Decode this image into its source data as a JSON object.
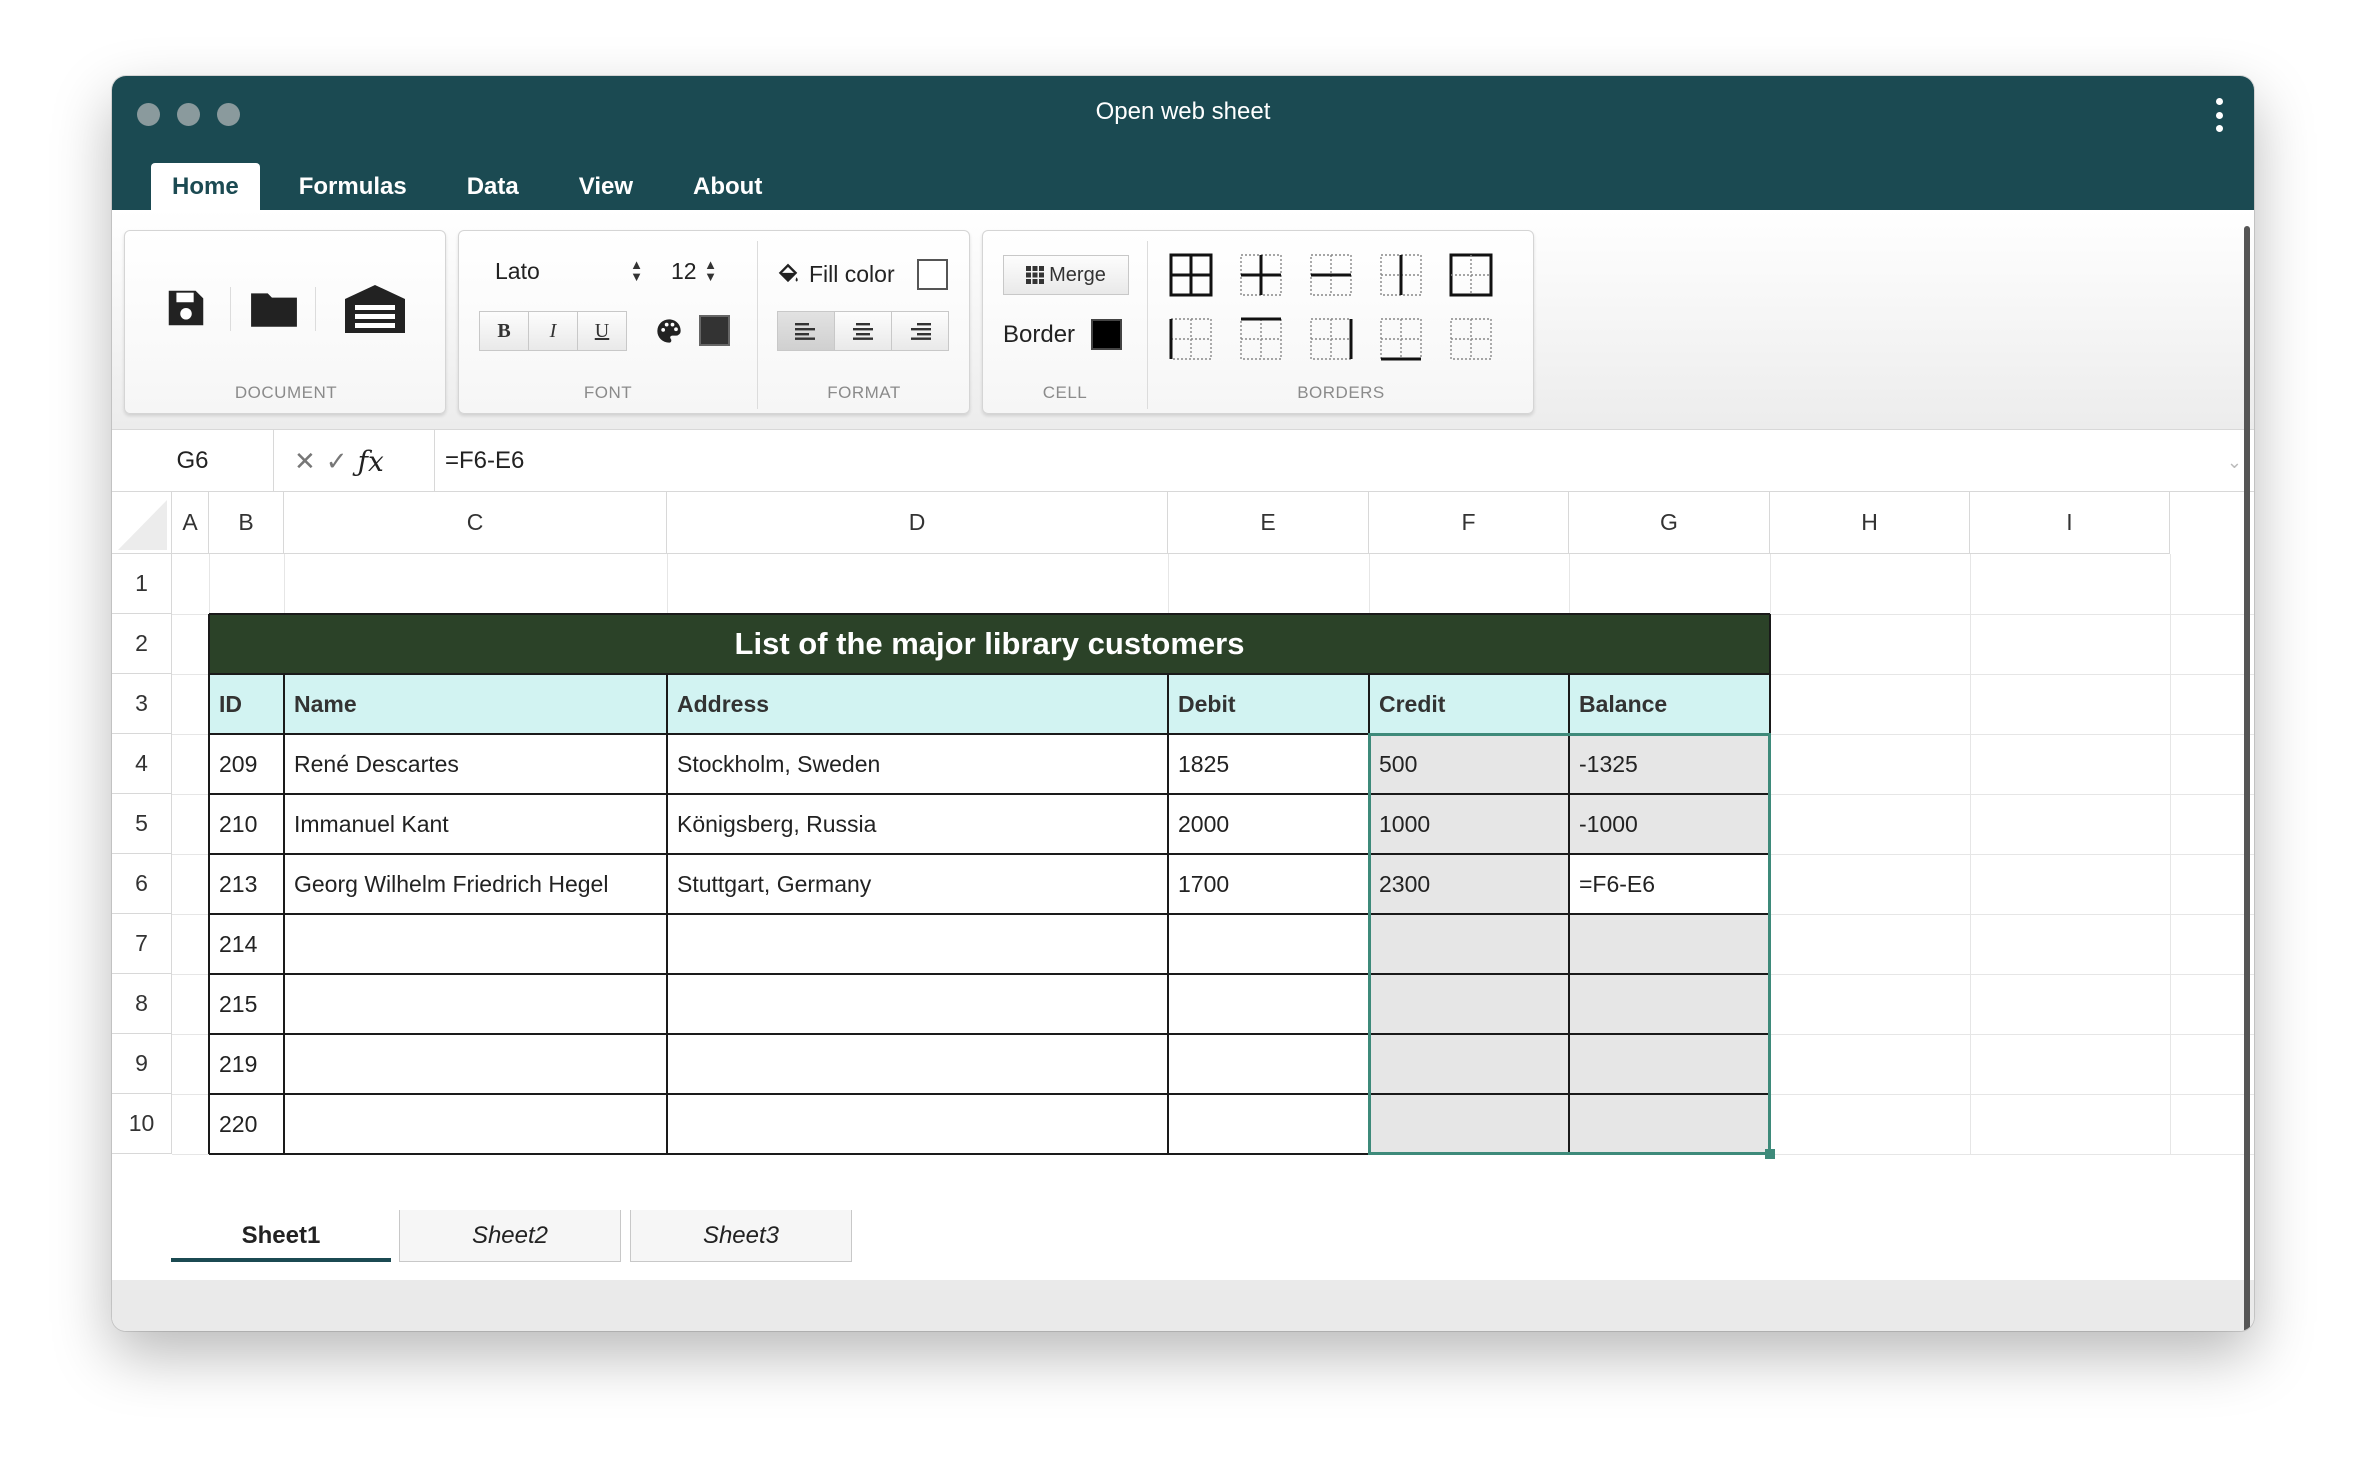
{
  "window": {
    "title": "Open web sheet"
  },
  "menu_tabs": [
    "Home",
    "Formulas",
    "Data",
    "View",
    "About"
  ],
  "ribbon": {
    "document_label": "DOCUMENT",
    "font_label": "FONT",
    "format_label": "FORMAT",
    "cell_label": "CELL",
    "borders_label": "BORDERS",
    "font_family": "Lato",
    "font_size": "12",
    "bold": "B",
    "italic": "I",
    "underline": "U",
    "fill_color_label": "Fill color",
    "merge_label": "Merge",
    "border_label": "Border",
    "font_color": "#333333",
    "border_color": "#000000"
  },
  "formula_bar": {
    "cell_ref": "G6",
    "formula": "=F6-E6"
  },
  "columns": [
    "A",
    "B",
    "C",
    "D",
    "E",
    "F",
    "G",
    "H",
    "I"
  ],
  "rows": [
    "1",
    "2",
    "3",
    "4",
    "5",
    "6",
    "7",
    "8",
    "9",
    "10"
  ],
  "table": {
    "title": "List of the major library customers",
    "headers": [
      "ID",
      "Name",
      "Address",
      "Debit",
      "Credit",
      "Balance"
    ],
    "data": [
      [
        "209",
        "René Descartes",
        "Stockholm, Sweden",
        "1825",
        "500",
        "-1325"
      ],
      [
        "210",
        "Immanuel Kant",
        "Königsberg, Russia",
        "2000",
        "1000",
        "-1000"
      ],
      [
        "213",
        "Georg Wilhelm Friedrich Hegel",
        "Stuttgart, Germany",
        "1700",
        "2300",
        "=F6-E6"
      ],
      [
        "214",
        "",
        "",
        "",
        "",
        ""
      ],
      [
        "215",
        "",
        "",
        "",
        "",
        ""
      ],
      [
        "219",
        "",
        "",
        "",
        "",
        ""
      ],
      [
        "220",
        "",
        "",
        "",
        "",
        ""
      ]
    ]
  },
  "sheets": [
    "Sheet1",
    "Sheet2",
    "Sheet3"
  ],
  "colors": {
    "titlebar": "#1b4a52",
    "table_title_bg": "#2b4228",
    "header_bg": "#d2f3f2",
    "selection": "#3e8a7a"
  }
}
